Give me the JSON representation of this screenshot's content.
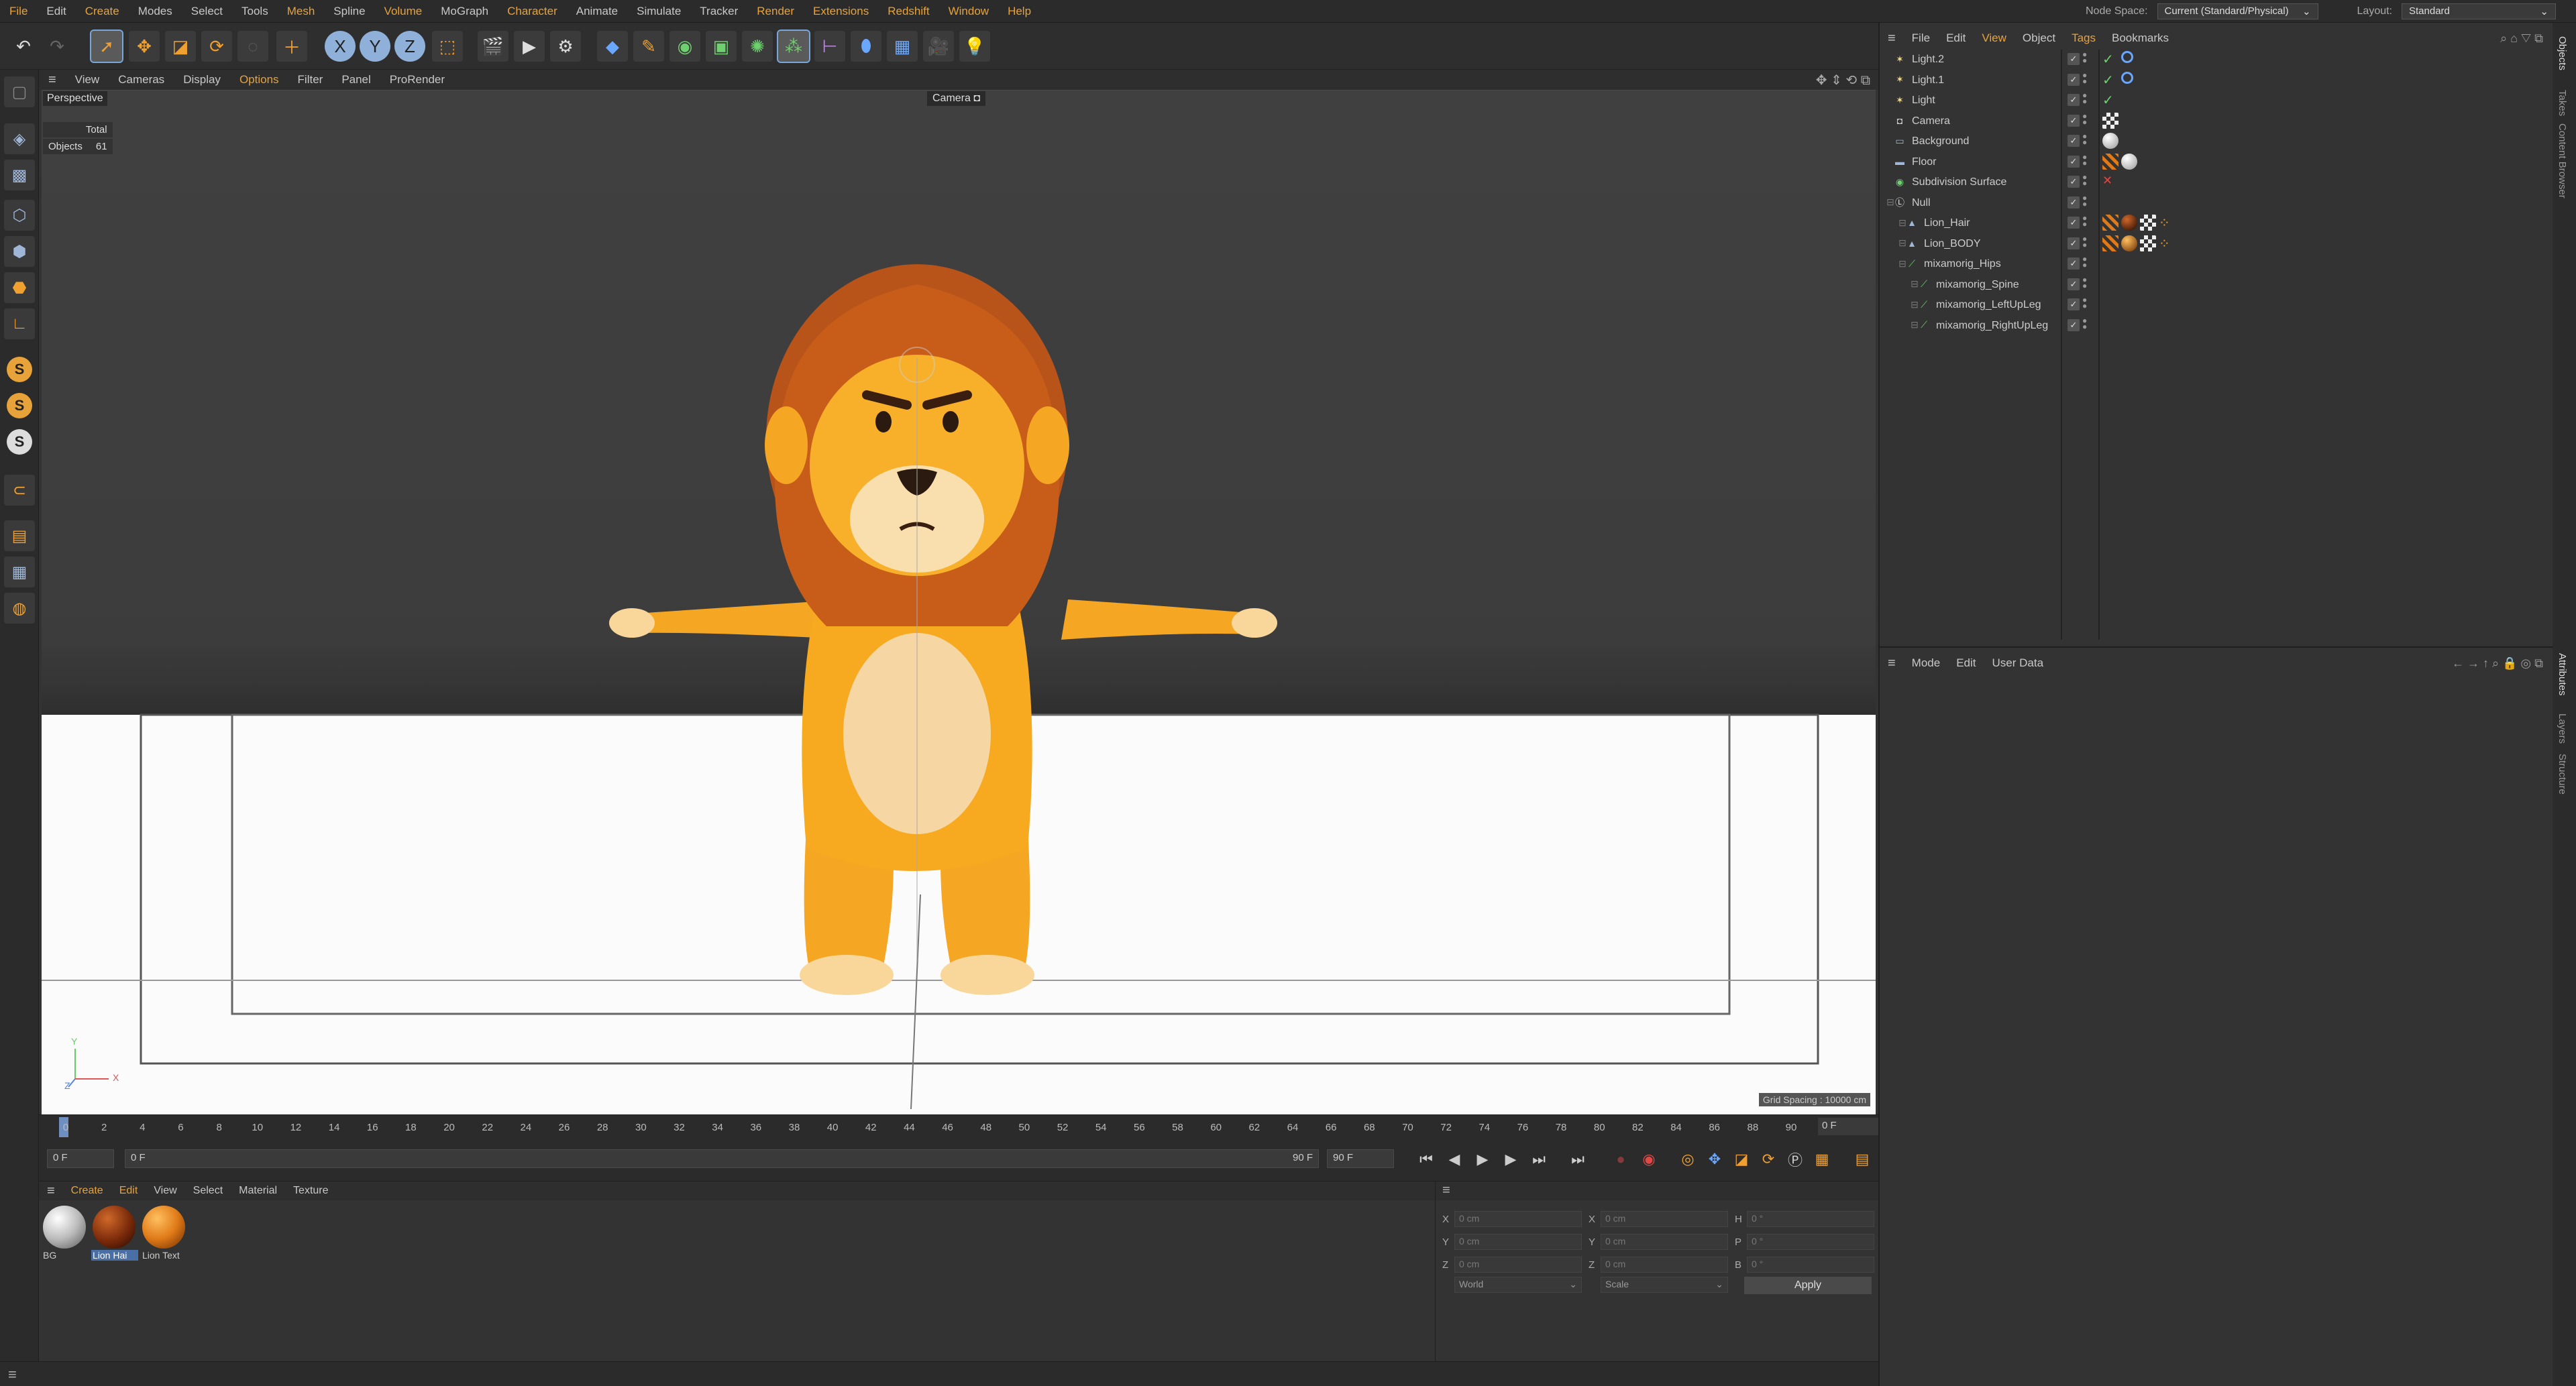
{
  "menubar": {
    "items": [
      "File",
      "Edit",
      "Create",
      "Modes",
      "Select",
      "Tools",
      "Mesh",
      "Spline",
      "Volume",
      "MoGraph",
      "Character",
      "Animate",
      "Simulate",
      "Tracker",
      "Render",
      "Extensions",
      "Redshift",
      "Window",
      "Help"
    ],
    "node_space_label": "Node Space:",
    "node_space_value": "Current (Standard/Physical)",
    "layout_label": "Layout:",
    "layout_value": "Standard"
  },
  "viewport_menu": {
    "items": [
      "View",
      "Cameras",
      "Display",
      "Options",
      "Filter",
      "Panel",
      "ProRender"
    ]
  },
  "viewport": {
    "view_name": "Perspective",
    "camera_label": "Camera",
    "hud_total": "Total",
    "hud_objects_label": "Objects",
    "hud_objects_value": "61",
    "grid_spacing": "Grid Spacing : 10000 cm",
    "axis_y": "Y",
    "axis_x": "X",
    "axis_z": "Z"
  },
  "timeline": {
    "ticks": [
      "0",
      "2",
      "4",
      "6",
      "8",
      "10",
      "12",
      "14",
      "16",
      "18",
      "20",
      "22",
      "24",
      "26",
      "28",
      "30",
      "32",
      "34",
      "36",
      "38",
      "40",
      "42",
      "44",
      "46",
      "48",
      "50",
      "52",
      "54",
      "56",
      "58",
      "60",
      "62",
      "64",
      "66",
      "68",
      "70",
      "72",
      "74",
      "76",
      "78",
      "80",
      "82",
      "84",
      "86",
      "88",
      "90"
    ],
    "current_frame": "0 F"
  },
  "transport": {
    "start_field": "0 F",
    "range_start": "0 F",
    "range_end": "90 F",
    "end_field": "90 F"
  },
  "material_manager": {
    "menu": [
      "Create",
      "Edit",
      "View",
      "Select",
      "Material",
      "Texture"
    ],
    "materials": [
      {
        "label": "BG",
        "color": "#e0e0e0",
        "selected": false
      },
      {
        "label": "Lion Hai",
        "color": "#8a3a10",
        "selected": true
      },
      {
        "label": "Lion Text",
        "color": "#e07a18",
        "selected": false
      }
    ]
  },
  "coordinates": {
    "rows": [
      {
        "a_label": "X",
        "a_val": "0 cm",
        "b_label": "X",
        "b_val": "0 cm",
        "c_label": "H",
        "c_val": "0 °"
      },
      {
        "a_label": "Y",
        "a_val": "0 cm",
        "b_label": "Y",
        "b_val": "0 cm",
        "c_label": "P",
        "c_val": "0 °"
      },
      {
        "a_label": "Z",
        "a_val": "0 cm",
        "b_label": "Z",
        "b_val": "0 cm",
        "c_label": "B",
        "c_val": "0 °"
      }
    ],
    "space": "World",
    "mode": "Scale",
    "apply": "Apply"
  },
  "object_manager": {
    "menu": [
      "File",
      "Edit",
      "View",
      "Object",
      "Tags",
      "Bookmarks"
    ],
    "objects": [
      {
        "name": "Light.2",
        "icon": "light-icon",
        "indent": 0
      },
      {
        "name": "Light.1",
        "icon": "light-icon",
        "indent": 0
      },
      {
        "name": "Light",
        "icon": "light-icon",
        "indent": 0
      },
      {
        "name": "Camera",
        "icon": "camera-icon",
        "indent": 0
      },
      {
        "name": "Background",
        "icon": "background-icon",
        "indent": 0
      },
      {
        "name": "Floor",
        "icon": "floor-icon",
        "indent": 0
      },
      {
        "name": "Subdivision Surface",
        "icon": "subdivision-icon",
        "indent": 0
      },
      {
        "name": "Null",
        "icon": "null-icon",
        "indent": 0
      },
      {
        "name": "Lion_Hair",
        "icon": "mesh-icon",
        "indent": 1
      },
      {
        "name": "Lion_BODY",
        "icon": "mesh-icon",
        "indent": 1
      },
      {
        "name": "mixamorig_Hips",
        "icon": "joint-icon",
        "indent": 1
      },
      {
        "name": "mixamorig_Spine",
        "icon": "joint-icon",
        "indent": 2
      },
      {
        "name": "mixamorig_LeftUpLeg",
        "icon": "joint-icon",
        "indent": 2
      },
      {
        "name": "mixamorig_RightUpLeg",
        "icon": "joint-icon",
        "indent": 2
      }
    ]
  },
  "attribute_manager": {
    "menu": [
      "Mode",
      "Edit",
      "User Data"
    ]
  },
  "right_tabs": [
    "Objects",
    "Takes",
    "Content Browser",
    "Attributes",
    "Layers",
    "Structure"
  ],
  "colors": {
    "accent": "#e8a23a",
    "selection": "#4a6fa5"
  }
}
